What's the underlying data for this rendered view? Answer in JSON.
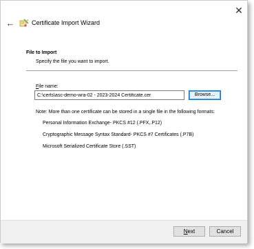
{
  "window": {
    "title": "Certificate Import Wizard",
    "close_glyph": "✕",
    "back_glyph": "←",
    "icon": "certificate-wizard-icon"
  },
  "header": {
    "section_title": "File to Import",
    "section_subtitle": "Specify the file you want to import."
  },
  "file": {
    "label_access": "F",
    "label_rest": "ile name:",
    "value": "C:\\certs\\asc-demo-wra-02 - 2023-2024 Certificate.cer",
    "browse_label": "Browse..."
  },
  "note": {
    "text": "Note:  More than one certificate can be stored in a single file in the following formats:",
    "formats": [
      "Personal Information Exchange- PKCS #12 (.PFX,.P12)",
      "Cryptographic Message Syntax Standard- PKCS #7 Certificates (.P7B)",
      "Microsoft Serialized Certificate Store (.SST)"
    ]
  },
  "footer": {
    "next_access": "N",
    "next_rest": "ext",
    "cancel_label": "Cancel"
  }
}
